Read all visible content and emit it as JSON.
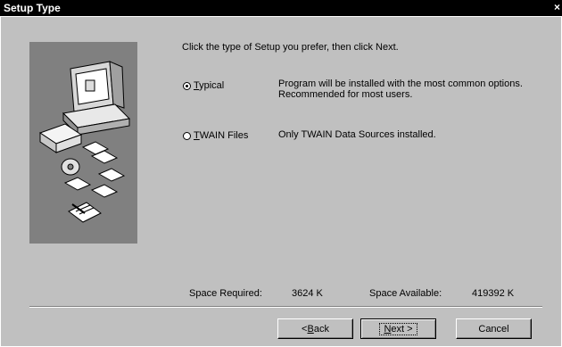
{
  "window": {
    "title": "Setup Type",
    "close_glyph": "×"
  },
  "instruction": "Click the type of Setup you prefer, then click Next.",
  "options": [
    {
      "label_prefix": "",
      "label_mnemonic": "T",
      "label_rest": "ypical",
      "selected": true,
      "description": "Program will be installed with the most common options. Recommended for most users."
    },
    {
      "label_prefix": "",
      "label_mnemonic": "T",
      "label_rest": "WAIN Files",
      "selected": false,
      "description": "Only TWAIN Data Sources installed."
    }
  ],
  "space": {
    "required_label": "Space Required:",
    "required_value": "3624 K",
    "available_label": "Space Available:",
    "available_value": "419392 K"
  },
  "buttons": {
    "back": {
      "prefix": "< ",
      "mnemonic": "B",
      "rest": "ack"
    },
    "next": {
      "mnemonic": "N",
      "rest": "ext >"
    },
    "cancel": "Cancel"
  },
  "colors": {
    "panel_bg": "#808080",
    "face": "#c0c0c0",
    "title_bg": "#000000"
  },
  "icons": [
    "computer-icon",
    "disk-drive-icon",
    "cd-icon",
    "floppy-disk-icon",
    "document-icon"
  ]
}
